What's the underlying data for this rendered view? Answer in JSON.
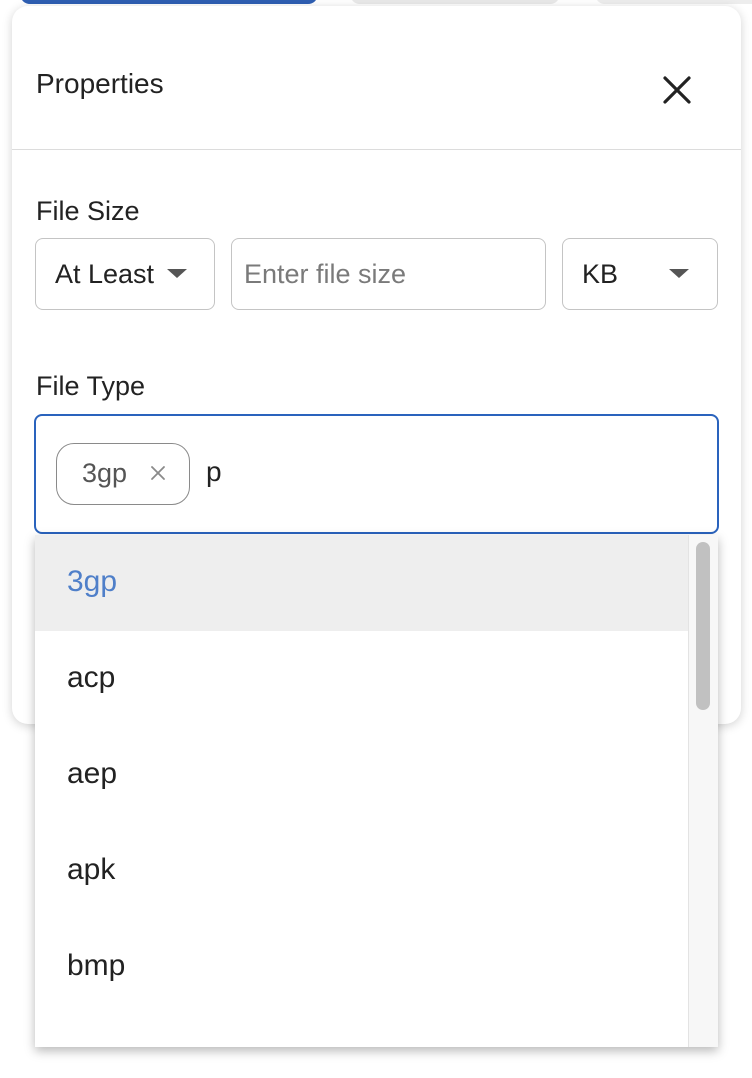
{
  "panel": {
    "title": "Properties"
  },
  "file_size": {
    "label": "File Size",
    "comparison": "At Least",
    "input_value": "",
    "input_placeholder": "Enter file size",
    "unit": "KB"
  },
  "file_type": {
    "label": "File Type",
    "chips": [
      "3gp"
    ],
    "input_value": "p",
    "options": [
      "3gp",
      "acp",
      "aep",
      "apk",
      "bmp"
    ],
    "highlighted_option": "3gp"
  },
  "colors": {
    "accent": "#2a63bd",
    "active_tab": "#2f5fb3",
    "highlight_text": "#4f7fc9",
    "highlight_bg": "#eeeeee"
  },
  "icons": {
    "close": "close-icon",
    "chip_remove": "chip-remove-icon",
    "dropdown_caret": "chevron-down-icon"
  }
}
